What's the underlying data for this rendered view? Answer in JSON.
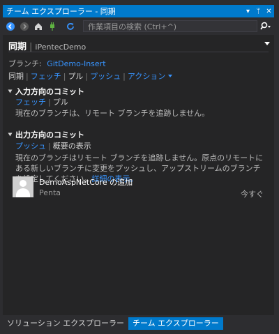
{
  "window": {
    "title": "チーム エクスプローラー - 同期",
    "buttons": {
      "dropdown": "▾",
      "pin": "ᛘ",
      "close": "✕"
    }
  },
  "toolbar": {
    "search_placeholder": "作業項目の検索 (Ctrl+^)"
  },
  "page": {
    "title": "同期",
    "repo": "iPentecDemo"
  },
  "branch": {
    "label": "ブランチ:",
    "name": "GitDemo-Insert"
  },
  "actions": {
    "sync": "同期",
    "fetch": "フェッチ",
    "pull": "プル",
    "push": "プッシュ",
    "action": "アクション"
  },
  "incoming": {
    "heading": "入力方向のコミット",
    "fetch": "フェッチ",
    "pull": "プル",
    "message": "現在のブランチは、リモート ブランチを追跡しません。"
  },
  "outgoing": {
    "heading": "出力方向のコミット",
    "push": "プッシュ",
    "summary": "概要の表示",
    "message": "現在のブランチはリモート ブランチを追跡しません。原点のリモートにある新しいブランチに変更をプッシュし、アップストリームのブランチを設定してください。",
    "details_link": "詳細の表示。"
  },
  "commit": {
    "title": "DemoAspNetCore の追加",
    "author": "Penta",
    "time": "今すぐ"
  },
  "tabs": [
    {
      "label": "ソリューション エクスプローラー"
    },
    {
      "label": "チーム エクスプローラー"
    }
  ],
  "colors": {
    "accent": "#007acc",
    "link": "#3794ff",
    "panel": "#252526"
  }
}
